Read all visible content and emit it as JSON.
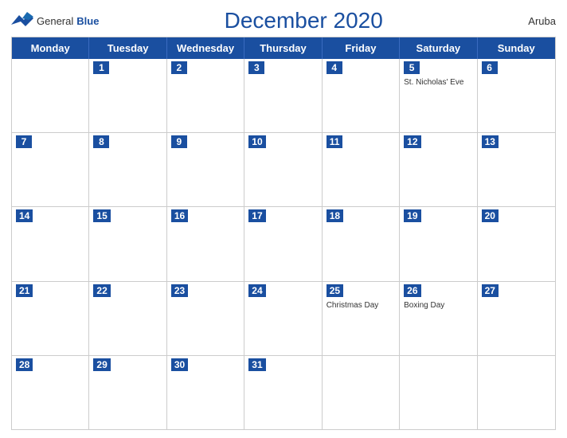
{
  "header": {
    "title": "December 2020",
    "country": "Aruba",
    "logo_general": "General",
    "logo_blue": "Blue"
  },
  "weekdays": [
    "Monday",
    "Tuesday",
    "Wednesday",
    "Thursday",
    "Friday",
    "Saturday",
    "Sunday"
  ],
  "rows": [
    [
      {
        "day": "",
        "event": ""
      },
      {
        "day": "1",
        "event": ""
      },
      {
        "day": "2",
        "event": ""
      },
      {
        "day": "3",
        "event": ""
      },
      {
        "day": "4",
        "event": ""
      },
      {
        "day": "5",
        "event": "St. Nicholas' Eve"
      },
      {
        "day": "6",
        "event": ""
      }
    ],
    [
      {
        "day": "7",
        "event": ""
      },
      {
        "day": "8",
        "event": ""
      },
      {
        "day": "9",
        "event": ""
      },
      {
        "day": "10",
        "event": ""
      },
      {
        "day": "11",
        "event": ""
      },
      {
        "day": "12",
        "event": ""
      },
      {
        "day": "13",
        "event": ""
      }
    ],
    [
      {
        "day": "14",
        "event": ""
      },
      {
        "day": "15",
        "event": ""
      },
      {
        "day": "16",
        "event": ""
      },
      {
        "day": "17",
        "event": ""
      },
      {
        "day": "18",
        "event": ""
      },
      {
        "day": "19",
        "event": ""
      },
      {
        "day": "20",
        "event": ""
      }
    ],
    [
      {
        "day": "21",
        "event": ""
      },
      {
        "day": "22",
        "event": ""
      },
      {
        "day": "23",
        "event": ""
      },
      {
        "day": "24",
        "event": ""
      },
      {
        "day": "25",
        "event": "Christmas Day"
      },
      {
        "day": "26",
        "event": "Boxing Day"
      },
      {
        "day": "27",
        "event": ""
      }
    ],
    [
      {
        "day": "28",
        "event": ""
      },
      {
        "day": "29",
        "event": ""
      },
      {
        "day": "30",
        "event": ""
      },
      {
        "day": "31",
        "event": ""
      },
      {
        "day": "",
        "event": ""
      },
      {
        "day": "",
        "event": ""
      },
      {
        "day": "",
        "event": ""
      }
    ]
  ],
  "colors": {
    "blue": "#1a4fa0",
    "white": "#ffffff",
    "border": "#cccccc"
  }
}
